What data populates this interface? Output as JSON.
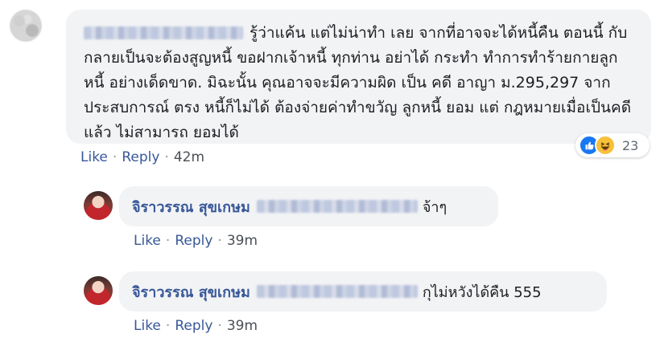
{
  "comment": {
    "text": "รู้ว่าแค้น แต่ไม่น่าทำ เลย จากที่อาจจะได้หนี้คืน ตอนนี้ กับกลายเป็นจะต้องสูญหนี้ ขอฝากเจ้าหนี้ ทุกท่าน อย่าได้ กระทำ ทำการทำร้ายกายลูกหนี้ อย่างเด็ดขาด. มิฉะนั้น คุณอาจจะมีความผิด เป็น คดี อาญา ม.295,297 จากประสบการณ์ ตรง หนี้ก็ไม่ได้ ต้องจ่ายค่าทำขวัญ ลูกหนี้ ยอม แต่ กฎหมายเมื่อเป็นคดีแล้ว ไม่สามารถ ยอมได้",
    "like_label": "Like",
    "reply_label": "Reply",
    "time": "42m",
    "reaction_count": "23",
    "icons": [
      "like-icon",
      "haha-icon"
    ]
  },
  "replies": [
    {
      "author": "จิราวรรณ สุขเกษม",
      "text": "จ้าๆ",
      "like_label": "Like",
      "reply_label": "Reply",
      "time": "39m"
    },
    {
      "author": "จิราวรรณ สุขเกษม",
      "text": "กุไม่หวังได้คืน 555",
      "like_label": "Like",
      "reply_label": "Reply",
      "time": "39m"
    }
  ],
  "colors": {
    "bubble": "#f2f3f5",
    "author": "#385898",
    "link": "#385898",
    "like_reaction": "#1877f2",
    "haha_reaction": "#f7c03a"
  }
}
